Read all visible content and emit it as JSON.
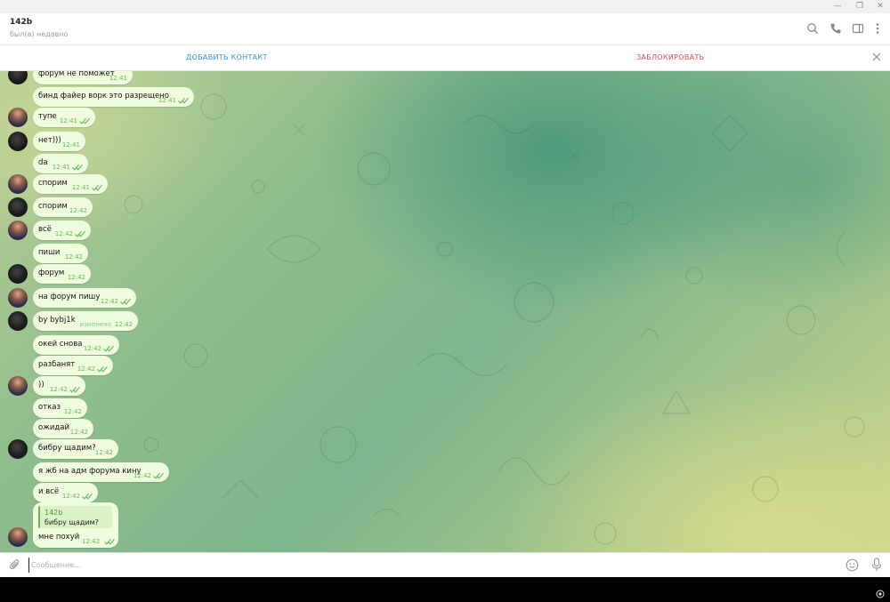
{
  "header": {
    "title": "142b",
    "status": "был(а) недавно"
  },
  "actions": {
    "add_contact": "ДОБАВИТЬ КОНТАКТ",
    "block": "ЗАБЛОКИРОВАТЬ"
  },
  "messages": [
    {
      "text": "форум не поможет",
      "time": "12:41",
      "avatar": "dark",
      "read": false
    },
    {
      "text": "бинд файер ворк это разрещено",
      "time": "12:41",
      "avatar": "none",
      "read": true
    },
    {
      "text": "тупе",
      "time": "12:41",
      "avatar": "photo",
      "read": true
    },
    {
      "text": "нет)))",
      "time": "12:41",
      "avatar": "dark",
      "read": false
    },
    {
      "text": "da",
      "time": "12:41",
      "avatar": "none",
      "read": true
    },
    {
      "text": "спорим",
      "time": "12:41",
      "avatar": "photo",
      "read": true
    },
    {
      "text": "спорим",
      "time": "12:42",
      "avatar": "dark",
      "read": false
    },
    {
      "text": "всё",
      "time": "12:42",
      "avatar": "photo",
      "read": true
    },
    {
      "text": "пиши",
      "time": "12:42",
      "avatar": "none",
      "read": false
    },
    {
      "text": "форум",
      "time": "12:42",
      "avatar": "dark",
      "read": false
    },
    {
      "text": "на форум пишу",
      "time": "12:42",
      "avatar": "photo",
      "read": true
    },
    {
      "text": "by bybj1k",
      "time": "12:42",
      "avatar": "dark",
      "read": false,
      "edited": "изменено"
    },
    {
      "text": "окей снова",
      "time": "12:42",
      "avatar": "none",
      "read": true
    },
    {
      "text": "разбанят",
      "time": "12:42",
      "avatar": "none",
      "read": true
    },
    {
      "text": "))",
      "time": "12:42",
      "avatar": "photo",
      "read": true
    },
    {
      "text": "отказ",
      "time": "12:42",
      "avatar": "none",
      "read": false
    },
    {
      "text": "ожидай",
      "time": "12:42",
      "avatar": "none",
      "read": false
    },
    {
      "text": "бибру щадим?",
      "time": "12:42",
      "avatar": "dark",
      "read": false
    },
    {
      "text": "я жб на адм форума кину",
      "time": "12:42",
      "avatar": "none",
      "read": true
    },
    {
      "text": "и всё",
      "time": "12:42",
      "avatar": "none",
      "read": true
    }
  ],
  "reply_message": {
    "quote_author": "142b",
    "quote_text": "бибру щадим?",
    "text": "мне похуй",
    "time": "12:42",
    "avatar": "photo",
    "read": true
  },
  "input": {
    "placeholder": "Сообщение..."
  },
  "colors": {
    "bubble": "#effdde",
    "time_green": "#6bb25f",
    "add_contact_blue": "#3a8ed0",
    "block_red": "#e0474c"
  },
  "icons": [
    "minimize-icon",
    "restore-icon",
    "close-window-icon",
    "search-icon",
    "phone-icon",
    "sidebar-icon",
    "more-icon",
    "close-icon",
    "attach-icon",
    "emoji-icon",
    "microphone-icon"
  ]
}
